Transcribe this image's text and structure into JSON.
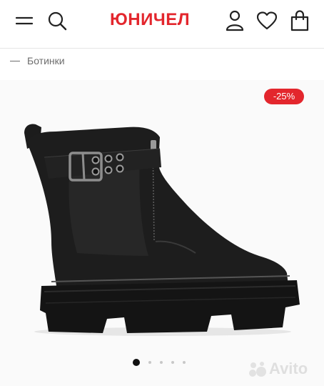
{
  "header": {
    "logo": "ЮНИЧЕЛ",
    "menu_icon": "menu-icon",
    "search_icon": "search-icon",
    "user_icon": "user-icon",
    "heart_icon": "heart-icon",
    "bag_icon": "bag-icon",
    "brand_color": "#e3262d"
  },
  "breadcrumb": {
    "label": "Ботинки"
  },
  "product": {
    "discount": "-25%",
    "image_subject": "black leather ankle boot with buckle strap and front zipper",
    "gallery_count": 5,
    "gallery_active_index": 0
  },
  "watermark": {
    "text": "Avito",
    "icon": "avito-logo-icon"
  }
}
